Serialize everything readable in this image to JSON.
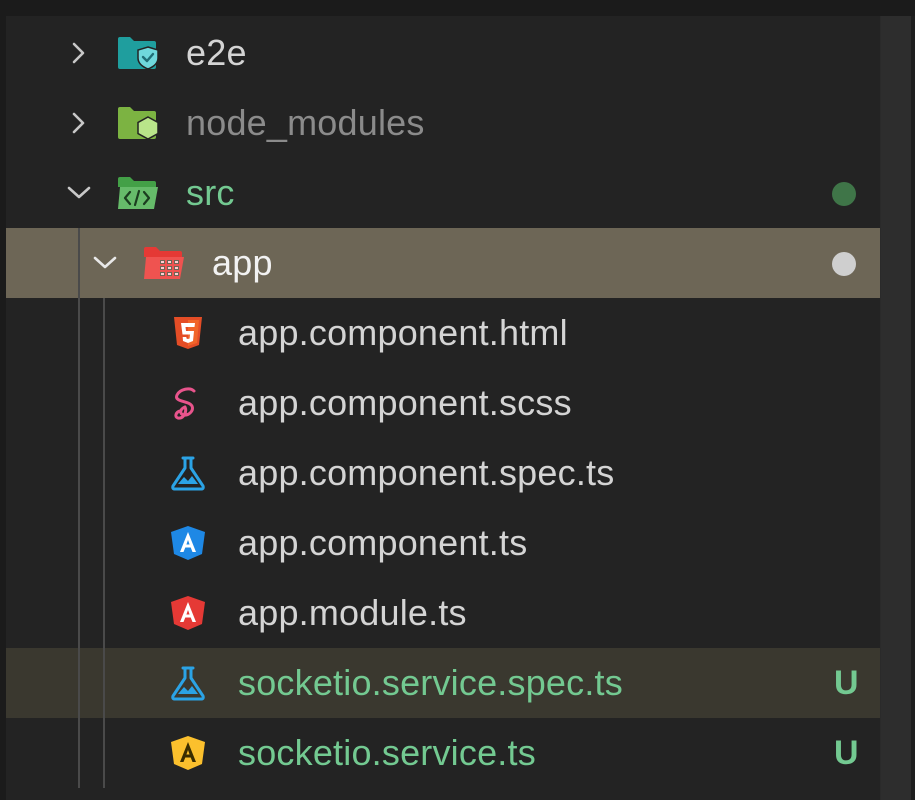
{
  "tree": {
    "items": [
      {
        "label": "e2e",
        "icon": "e2e-folder-icon",
        "expanded": false
      },
      {
        "label": "node_modules",
        "icon": "node-folder-icon",
        "expanded": false
      },
      {
        "label": "src",
        "icon": "src-folder-icon",
        "expanded": true,
        "decoration": "modified-dot"
      },
      {
        "label": "app",
        "icon": "app-folder-icon",
        "expanded": true,
        "selected": true,
        "decoration": "modified-dot"
      },
      {
        "label": "app.component.html",
        "icon": "html5-icon"
      },
      {
        "label": "app.component.scss",
        "icon": "sass-icon"
      },
      {
        "label": "app.component.spec.ts",
        "icon": "test-flask-icon"
      },
      {
        "label": "app.component.ts",
        "icon": "angular-component-icon"
      },
      {
        "label": "app.module.ts",
        "icon": "angular-module-icon"
      },
      {
        "label": "socketio.service.spec.ts",
        "icon": "test-flask-icon",
        "status": "U"
      },
      {
        "label": "socketio.service.ts",
        "icon": "angular-service-icon",
        "status": "U"
      }
    ]
  },
  "colors": {
    "background": "#232323",
    "selected_row": "#6d6656",
    "untracked_green": "#73c991",
    "text": "#d4d4d4",
    "dim_text": "#8b8b8b"
  }
}
